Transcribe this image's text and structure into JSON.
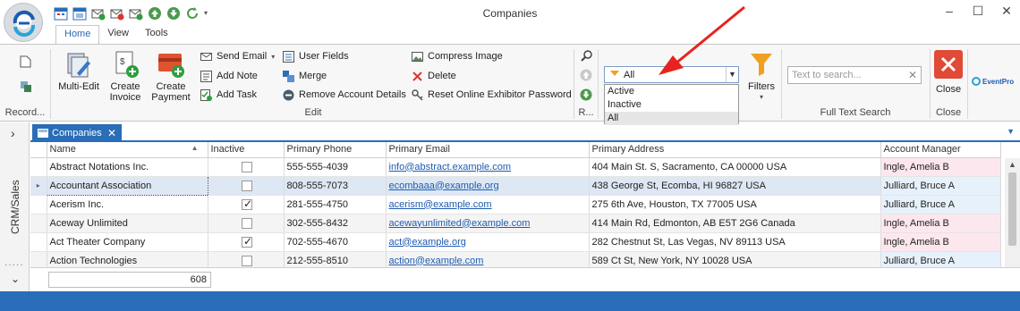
{
  "window": {
    "title": "Companies",
    "controls": [
      "–",
      "☐",
      "✕"
    ]
  },
  "ribbon": {
    "tabs": [
      "Home",
      "View",
      "Tools"
    ],
    "record_group_label": "Record...",
    "edit_group_label": "Edit",
    "r_group_label": "R...",
    "search_group_label": "Full Text Search",
    "close_group_label": "Close",
    "buttons": {
      "multi_edit": "Multi-Edit",
      "create_invoice_1": "Create",
      "create_invoice_2": "Invoice",
      "create_payment_1": "Create",
      "create_payment_2": "Payment",
      "send_email": "Send Email",
      "add_note": "Add Note",
      "add_task": "Add Task",
      "user_fields": "User Fields",
      "merge": "Merge",
      "remove_account_details": "Remove Account Details",
      "compress_image": "Compress Image",
      "delete": "Delete",
      "reset_password": "Reset Online Exhibitor Password",
      "filters": "Filters",
      "close": "Close",
      "brand": "EventPro"
    },
    "filter_combo": {
      "value": "All",
      "options": [
        "Active",
        "Inactive",
        "All"
      ],
      "selected_index": 2
    },
    "search": {
      "placeholder": "Text to search..."
    }
  },
  "nav": {
    "label": "CRM/Sales"
  },
  "doc_tab": {
    "label": "Companies"
  },
  "grid": {
    "columns": [
      "Name",
      "Inactive",
      "Primary Phone",
      "Primary Email",
      "Primary Address",
      "Account Manager"
    ],
    "rows": [
      {
        "name": "Abstract Notations Inc.",
        "inactive": false,
        "phone": "555-555-4039",
        "email": "info@abstract.example.com",
        "address": "404 Main St. S, Sacramento, CA 00000 USA",
        "manager": "Ingle, Amelia B"
      },
      {
        "name": "Accountant Association",
        "inactive": false,
        "phone": "808-555-7073",
        "email": "ecombaaa@example.org",
        "address": "438 George St, Ecomba, HI 96827 USA",
        "manager": "Julliard, Bruce A"
      },
      {
        "name": "Acerism Inc.",
        "inactive": true,
        "phone": "281-555-4750",
        "email": "acerism@example.com",
        "address": "275 6th Ave, Houston, TX 77005 USA",
        "manager": "Julliard, Bruce A"
      },
      {
        "name": "Aceway Unlimited",
        "inactive": false,
        "phone": "302-555-8432",
        "email": "acewayunlimited@example.com",
        "address": "414 Main Rd, Edmonton, AB E5T 2G6 Canada",
        "manager": "Ingle, Amelia B"
      },
      {
        "name": "Act Theater Company",
        "inactive": true,
        "phone": "702-555-4670",
        "email": "act@example.org",
        "address": "282 Chestnut St, Las Vegas, NV 89113 USA",
        "manager": "Ingle, Amelia B"
      },
      {
        "name": "Action Technologies",
        "inactive": false,
        "phone": "212-555-8510",
        "email": "action@example.com",
        "address": "589 Ct St, New York, NY 10028 USA",
        "manager": "Julliard, Bruce A"
      }
    ],
    "record_count": "608"
  },
  "colors": {
    "accent": "#2a6db8",
    "arrow": "#e8231f",
    "manager_pink": "#fde7ee",
    "manager_blue": "#e7f1fb"
  }
}
